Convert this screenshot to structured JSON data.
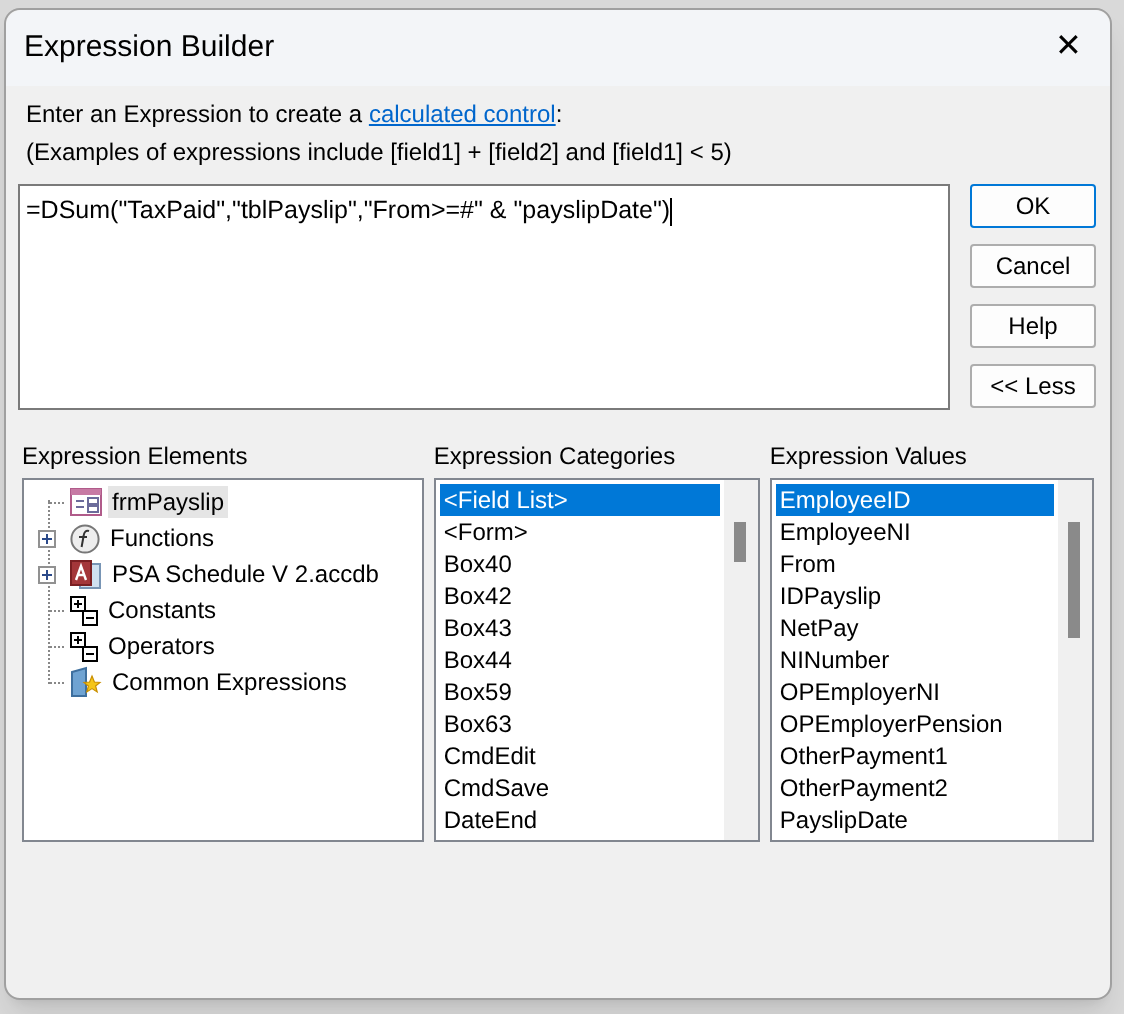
{
  "window": {
    "title": "Expression Builder",
    "close": "✕"
  },
  "instructions": {
    "before_link": "Enter an Expression to create a ",
    "link": "calculated control",
    "after_link": ":",
    "examples": "(Examples of expressions include [field1] + [field2] and [field1] < 5)"
  },
  "expression": {
    "value": "=DSum(\"TaxPaid\",\"tblPayslip\",\"From>=#\" & \"payslipDate\")"
  },
  "buttons": [
    "OK",
    "Cancel",
    "Help",
    "<< Less"
  ],
  "elements": {
    "label": "Expression Elements",
    "items": [
      {
        "label": "frmPayslip",
        "kind": "form",
        "selected": true
      },
      {
        "label": "Functions",
        "kind": "functions",
        "selected": false,
        "expanded": false
      },
      {
        "label": "PSA Schedule V 2.accdb",
        "kind": "database",
        "selected": false,
        "expanded": false
      },
      {
        "label": "Constants",
        "kind": "constants",
        "selected": false
      },
      {
        "label": "Operators",
        "kind": "operators",
        "selected": false
      },
      {
        "label": "Common Expressions",
        "kind": "common",
        "selected": false
      }
    ]
  },
  "categories": {
    "label": "Expression Categories",
    "items": [
      {
        "label": "<Field List>",
        "selected": true
      },
      {
        "label": "<Form>",
        "selected": false
      },
      {
        "label": "Box40",
        "selected": false
      },
      {
        "label": "Box42",
        "selected": false
      },
      {
        "label": "Box43",
        "selected": false
      },
      {
        "label": "Box44",
        "selected": false
      },
      {
        "label": "Box59",
        "selected": false
      },
      {
        "label": "Box63",
        "selected": false
      },
      {
        "label": "CmdEdit",
        "selected": false
      },
      {
        "label": "CmdSave",
        "selected": false
      },
      {
        "label": "DateEnd",
        "selected": false
      }
    ]
  },
  "values": {
    "label": "Expression Values",
    "items": [
      {
        "label": "EmployeeID",
        "selected": true
      },
      {
        "label": "EmployeeNI",
        "selected": false
      },
      {
        "label": "From",
        "selected": false
      },
      {
        "label": "IDPayslip",
        "selected": false
      },
      {
        "label": "NetPay",
        "selected": false
      },
      {
        "label": "NINumber",
        "selected": false
      },
      {
        "label": "OPEmployerNI",
        "selected": false
      },
      {
        "label": "OPEmployerPension",
        "selected": false
      },
      {
        "label": "OtherPayment1",
        "selected": false
      },
      {
        "label": "OtherPayment2",
        "selected": false
      },
      {
        "label": "PayslipDate",
        "selected": false
      }
    ]
  }
}
